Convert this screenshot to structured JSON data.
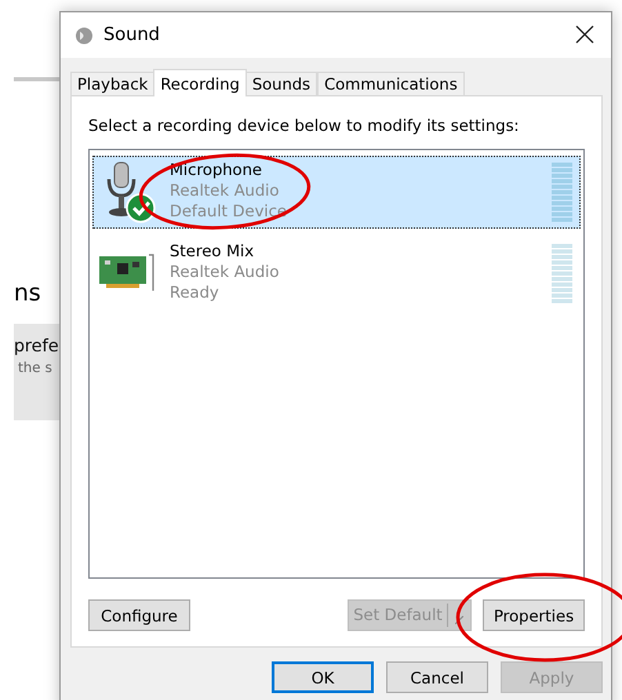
{
  "background": {
    "heading": "ns",
    "panel": {
      "title": "prefe",
      "subtitle": "the s"
    }
  },
  "window": {
    "title": "Sound"
  },
  "tabs": [
    {
      "label": "Playback",
      "selected": false
    },
    {
      "label": "Recording",
      "selected": true
    },
    {
      "label": "Sounds",
      "selected": false
    },
    {
      "label": "Communications",
      "selected": false
    }
  ],
  "instruction": "Select a recording device below to modify its settings:",
  "devices": [
    {
      "kind": "microphone",
      "name": "Microphone",
      "driver": "Realtek Audio",
      "status": "Default Device",
      "selected": true,
      "default": true
    },
    {
      "kind": "card",
      "name": "Stereo Mix",
      "driver": "Realtek Audio",
      "status": "Ready",
      "selected": false,
      "default": false
    }
  ],
  "panel_buttons": [
    {
      "kind": "plain",
      "label": "Configure",
      "disabled": false
    },
    {
      "kind": "split",
      "label": "Set Default",
      "disabled": true
    },
    {
      "kind": "plain",
      "label": "Properties",
      "disabled": false
    }
  ],
  "dialog_buttons": [
    {
      "label": "OK",
      "disabled": false,
      "default": true
    },
    {
      "label": "Cancel",
      "disabled": false,
      "default": false
    },
    {
      "label": "Apply",
      "disabled": true,
      "default": false
    }
  ]
}
